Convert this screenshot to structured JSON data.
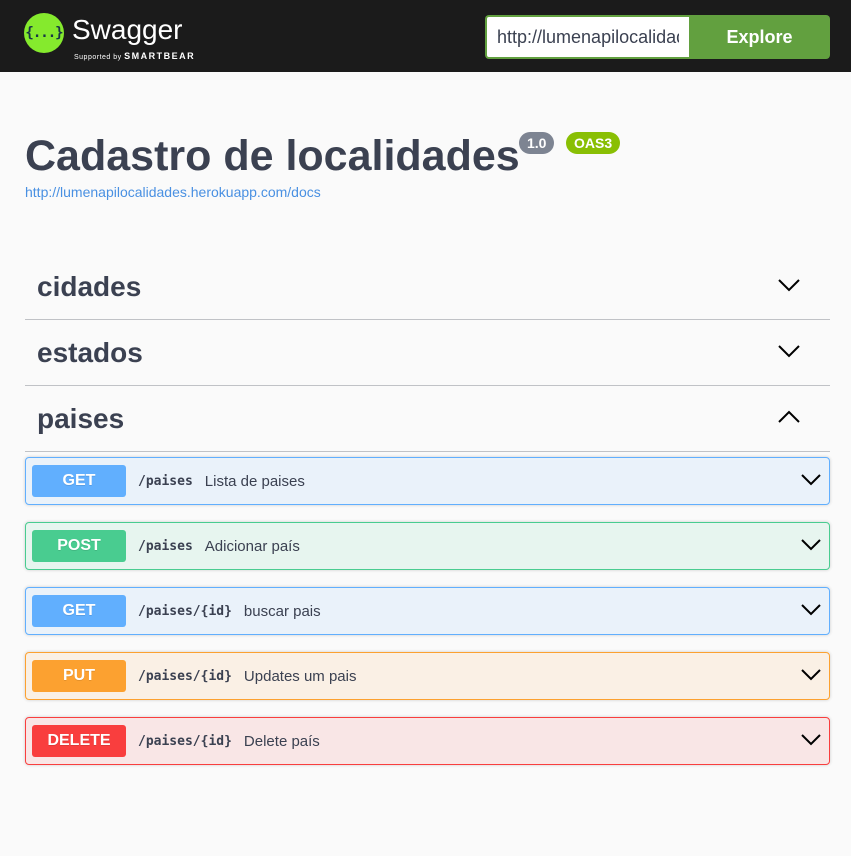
{
  "topbar": {
    "brand": "Swagger",
    "supported_by": "Supported by",
    "smartbear": "SMARTBEAR",
    "logo_glyph": "{...}",
    "url_value": "http://lumenapilocalidades.herokuapp.com/docs",
    "explore_label": "Explore"
  },
  "info": {
    "title": "Cadastro de localidades",
    "version": "1.0",
    "oas": "OAS3",
    "url": "http://lumenapilocalidades.herokuapp.com/docs"
  },
  "tags": [
    {
      "name": "cidades",
      "expanded": false
    },
    {
      "name": "estados",
      "expanded": false
    },
    {
      "name": "paises",
      "expanded": true
    }
  ],
  "operations": [
    {
      "method": "GET",
      "path": "/paises",
      "summary": "Lista de paises"
    },
    {
      "method": "POST",
      "path": "/paises",
      "summary": "Adicionar país"
    },
    {
      "method": "GET",
      "path": "/paises/{id}",
      "summary": "buscar pais"
    },
    {
      "method": "PUT",
      "path": "/paises/{id}",
      "summary": "Updates um pais"
    },
    {
      "method": "DELETE",
      "path": "/paises/{id}",
      "summary": "Delete país"
    }
  ],
  "colors": {
    "get": "#61affe",
    "post": "#49cc90",
    "put": "#fca130",
    "delete": "#f93e3e",
    "explore": "#62a03f",
    "topbar": "#1b1b1b"
  }
}
